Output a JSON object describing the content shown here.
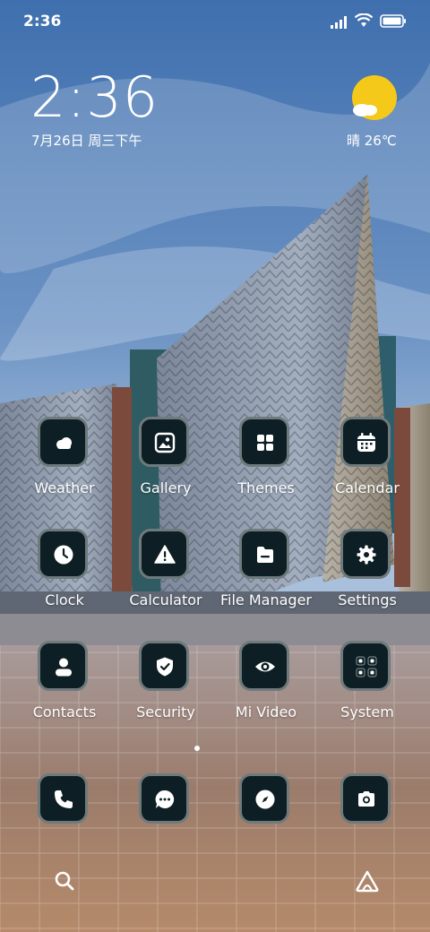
{
  "status_bar": {
    "time": "2:36",
    "icons": [
      "signal-icon",
      "wifi-icon",
      "battery-icon"
    ]
  },
  "clock_widget": {
    "time": "2:36",
    "date": "7月26日 周三下午"
  },
  "weather_widget": {
    "condition_icon": "sun-cloud-icon",
    "text": "晴 26℃"
  },
  "apps": [
    {
      "label": "Weather",
      "icon": "cloud-icon"
    },
    {
      "label": "Gallery",
      "icon": "image-icon"
    },
    {
      "label": "Themes",
      "icon": "grid-icon"
    },
    {
      "label": "Calendar",
      "icon": "calendar-icon"
    },
    {
      "label": "Clock",
      "icon": "clock-icon"
    },
    {
      "label": "Calculator",
      "icon": "warning-icon"
    },
    {
      "label": "File Manager",
      "icon": "folder-icon"
    },
    {
      "label": "Settings",
      "icon": "gear-icon"
    },
    {
      "label": "Contacts",
      "icon": "person-icon"
    },
    {
      "label": "Security",
      "icon": "shield-icon"
    },
    {
      "label": "Mi Video",
      "icon": "eye-icon"
    },
    {
      "label": "System",
      "icon": "folder-grid-icon"
    }
  ],
  "dock": [
    {
      "icon": "phone-icon"
    },
    {
      "icon": "message-icon"
    },
    {
      "icon": "compass-icon"
    },
    {
      "icon": "camera-icon"
    }
  ],
  "bottom_bar": {
    "left_icon": "search-icon",
    "right_icon": "launcher-icon"
  },
  "colors": {
    "tile_bg": "#0d1f24",
    "tile_border": "#6f7a7c",
    "accent_sun": "#f4c91a"
  }
}
